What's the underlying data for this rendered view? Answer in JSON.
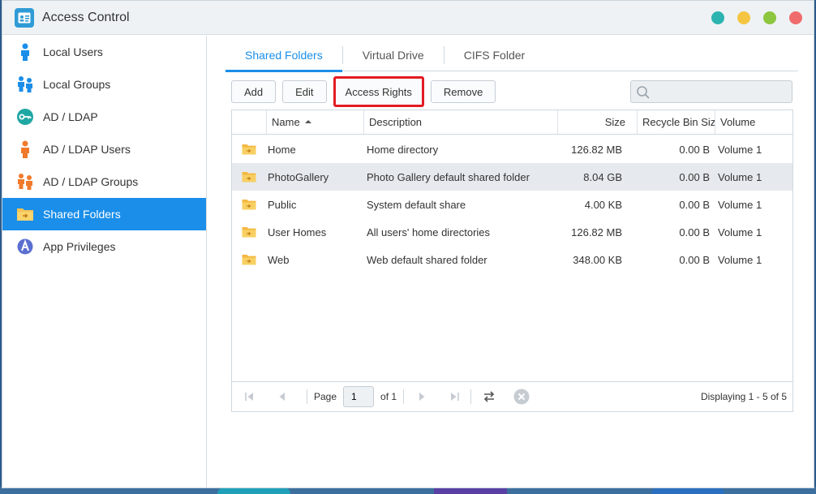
{
  "window": {
    "title": "Access Control"
  },
  "colors": {
    "accent": "#1a8ee9",
    "highlight": "#e31b23",
    "traffic": [
      "#2bb3b0",
      "#f5c542",
      "#8dc63f",
      "#f06b6b"
    ]
  },
  "sidebar": {
    "items": [
      {
        "label": "Local Users",
        "icon": "user-icon",
        "active": false
      },
      {
        "label": "Local Groups",
        "icon": "group-icon",
        "active": false
      },
      {
        "label": "AD / LDAP",
        "icon": "key-icon",
        "active": false
      },
      {
        "label": "AD / LDAP Users",
        "icon": "ldap-user-icon",
        "active": false
      },
      {
        "label": "AD / LDAP Groups",
        "icon": "ldap-group-icon",
        "active": false
      },
      {
        "label": "Shared Folders",
        "icon": "shared-folder-icon",
        "active": true
      },
      {
        "label": "App Privileges",
        "icon": "app-privileges-icon",
        "active": false
      }
    ]
  },
  "tabs": [
    {
      "label": "Shared Folders",
      "active": true
    },
    {
      "label": "Virtual Drive",
      "active": false
    },
    {
      "label": "CIFS Folder",
      "active": false
    }
  ],
  "toolbar": {
    "add": "Add",
    "edit": "Edit",
    "access_rights": "Access Rights",
    "remove": "Remove"
  },
  "search": {
    "placeholder": ""
  },
  "grid": {
    "headers": {
      "name": "Name",
      "description": "Description",
      "size": "Size",
      "recycle": "Recycle Bin Size",
      "volume": "Volume"
    },
    "rows": [
      {
        "name": "Home",
        "description": "Home directory",
        "size": "126.82 MB",
        "recycle": "0.00 B",
        "volume": "Volume 1"
      },
      {
        "name": "PhotoGallery",
        "description": "Photo Gallery default shared folder",
        "size": "8.04 GB",
        "recycle": "0.00 B",
        "volume": "Volume 1"
      },
      {
        "name": "Public",
        "description": "System default share",
        "size": "4.00 KB",
        "recycle": "0.00 B",
        "volume": "Volume 1"
      },
      {
        "name": "User Homes",
        "description": "All users' home directories",
        "size": "126.82 MB",
        "recycle": "0.00 B",
        "volume": "Volume 1"
      },
      {
        "name": "Web",
        "description": "Web default shared folder",
        "size": "348.00 KB",
        "recycle": "0.00 B",
        "volume": "Volume 1"
      }
    ]
  },
  "pager": {
    "page_label": "Page",
    "page_value": "1",
    "of_label": "of 1",
    "display": "Displaying 1 - 5 of 5"
  }
}
